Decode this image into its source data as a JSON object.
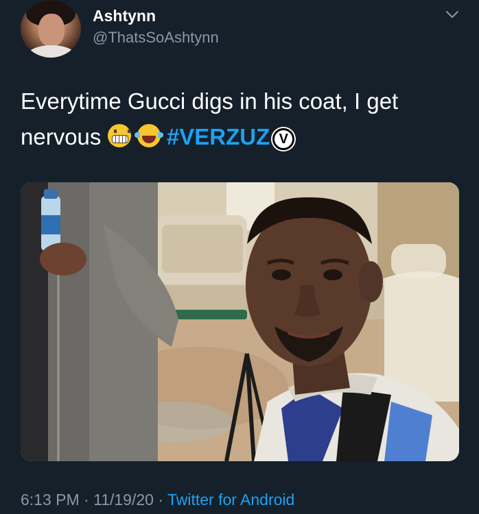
{
  "user": {
    "display_name": "Ashtynn",
    "handle": "@ThatsSoAshtynn"
  },
  "tweet": {
    "text_line1": "Everytime Gucci digs in his coat, I get",
    "text_line2": "nervous",
    "emojis": [
      "grimacing-face",
      "face-with-tears-of-joy"
    ],
    "hashtag": "#VERZUZ",
    "badge_letter": "V"
  },
  "footer": {
    "time": "6:13 PM",
    "separator": " · ",
    "date": "11/19/20",
    "source": "Twitter for Android"
  },
  "colors": {
    "background": "#15202b",
    "text": "#ffffff",
    "muted": "#8899a6",
    "accent": "#1da1f2"
  },
  "icons": {
    "menu": "chevron-down-icon"
  }
}
